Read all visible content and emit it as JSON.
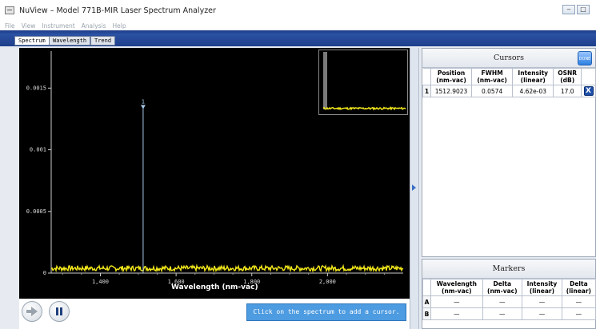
{
  "window": {
    "title": "NuView – Model 771B-MIR Laser Spectrum Analyzer",
    "controls": [
      "minimize-icon",
      "maximize-icon"
    ]
  },
  "menu": [
    "File",
    "View",
    "Instrument",
    "Analysis",
    "Help"
  ],
  "tabs": [
    {
      "label": "Spectrum",
      "active": true
    },
    {
      "label": "Wavelength",
      "active": false
    },
    {
      "label": "Trend",
      "active": false
    }
  ],
  "plot": {
    "xlabel": "Wavelength (nm-vac)",
    "y_ticks": [
      "0.0015",
      "0.001",
      "0.0005",
      "0"
    ],
    "x_ticks": [
      "1,400",
      "1,600",
      "1,800",
      "2,000"
    ],
    "peak_label": "1",
    "colors": {
      "trace": "#f2e81a",
      "cursor": "#a8c8e8",
      "background": "#000000"
    }
  },
  "chart_data": {
    "type": "line",
    "xlabel": "Wavelength (nm-vac)",
    "ylabel": "",
    "xlim": [
      1270,
      2200
    ],
    "ylim": [
      0,
      0.0018
    ],
    "x_ticks": [
      1400,
      1600,
      1800,
      2000
    ],
    "y_ticks": [
      0,
      0.0005,
      0.001,
      0.0015
    ],
    "noise_floor": 3e-05,
    "cursor": {
      "label": "1",
      "x": 1512.9023,
      "y": 0.00135
    }
  },
  "controls": {
    "play_icon": "play-arrow-icon",
    "pause_icon": "pause-icon",
    "hint": "Click on the spectrum to add a cursor."
  },
  "cursors": {
    "title": "Cursors",
    "done_label": "DONE",
    "columns": [
      {
        "line1": "Position",
        "line2": "(nm-vac)"
      },
      {
        "line1": "FWHM",
        "line2": "(nm-vac)"
      },
      {
        "line1": "Intensity",
        "line2": "(linear)"
      },
      {
        "line1": "OSNR",
        "line2": "(dB)"
      }
    ],
    "rows": [
      {
        "index": "1",
        "position": "1512.9023",
        "fwhm": "0.0574",
        "intensity": "4.62e-03",
        "osnr": "17.0",
        "delete_label": "X"
      }
    ]
  },
  "markers": {
    "title": "Markers",
    "columns": [
      {
        "line1": "Wavelength",
        "line2": "(nm-vac)"
      },
      {
        "line1": "Delta",
        "line2": "(nm-vac)"
      },
      {
        "line1": "Intensity",
        "line2": "(linear)"
      },
      {
        "line1": "Delta",
        "line2": "(linear)"
      }
    ],
    "rows": [
      {
        "index": "A",
        "values": [
          "—",
          "—",
          "—",
          "—"
        ]
      },
      {
        "index": "B",
        "values": [
          "—",
          "—",
          "—",
          "—"
        ]
      }
    ]
  }
}
